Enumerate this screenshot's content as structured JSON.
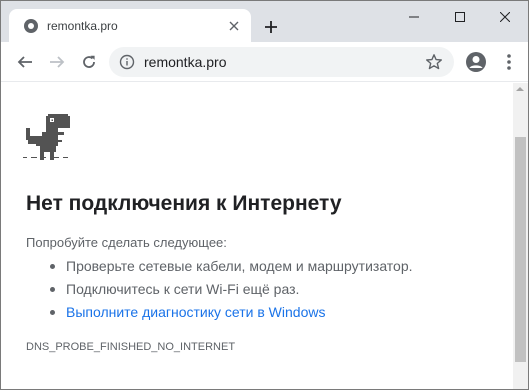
{
  "browser": {
    "tab": {
      "title": "remontka.pro",
      "favicon": "globe-icon"
    },
    "new_tab_symbol": "+",
    "window_controls": [
      "minimize-icon",
      "maximize-icon",
      "close-icon"
    ]
  },
  "toolbar": {
    "url": "remontka.pro",
    "icons": [
      "back-icon",
      "forward-icon",
      "reload-icon",
      "info-icon",
      "star-icon",
      "profile-icon",
      "menu-icon"
    ]
  },
  "page": {
    "heading": "Нет подключения к Интернету",
    "suggest_lead": "Попробуйте сделать следующее:",
    "suggestions": [
      "Проверьте сетевые кабели, модем и маршрутизатор.",
      "Подключитесь к сети Wi-Fi ещё раз.",
      "Выполните диагностику сети в Windows"
    ],
    "error_code": "DNS_PROBE_FINISHED_NO_INTERNET"
  },
  "colors": {
    "tabstrip": "#dee1e6",
    "link": "#1a73e8",
    "heading": "#202124",
    "body_text": "#5f6368"
  }
}
